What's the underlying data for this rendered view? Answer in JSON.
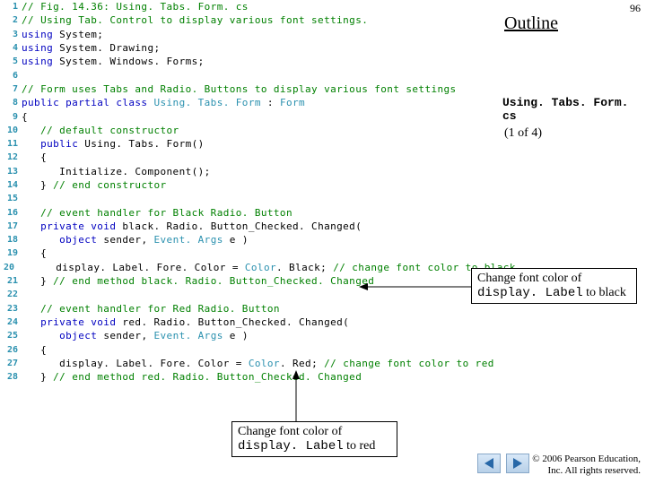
{
  "page_number": "96",
  "heading": "Outline",
  "source_file": "Using. Tabs. Form. cs",
  "page_indicator": "(1 of 4)",
  "callouts": {
    "black": {
      "line1": "Change font color of",
      "mono": "display. Label",
      "suffix": " to black"
    },
    "red": {
      "line1": "Change font color of",
      "mono": "display. Label",
      "suffix": " to red"
    }
  },
  "copyright": {
    "line1": "© 2006 Pearson Education,",
    "line2": "Inc. All rights reserved."
  },
  "nav": {
    "prev": "Previous slide",
    "next": "Next slide"
  },
  "code": {
    "l1": {
      "ln": "1",
      "ind": 0,
      "seg": [
        {
          "t": "// Fig. 14.36: Using. Tabs. Form. cs",
          "c": "c-comment"
        }
      ]
    },
    "l2": {
      "ln": "2",
      "ind": 0,
      "seg": [
        {
          "t": "// Using Tab. Control to display various font settings.",
          "c": "c-comment"
        }
      ]
    },
    "l3": {
      "ln": "3",
      "ind": 0,
      "seg": [
        {
          "t": "using ",
          "c": "c-key"
        },
        {
          "t": "System;",
          "c": "c-txt"
        }
      ]
    },
    "l4": {
      "ln": "4",
      "ind": 0,
      "seg": [
        {
          "t": "using ",
          "c": "c-key"
        },
        {
          "t": "System. Drawing;",
          "c": "c-txt"
        }
      ]
    },
    "l5": {
      "ln": "5",
      "ind": 0,
      "seg": [
        {
          "t": "using ",
          "c": "c-key"
        },
        {
          "t": "System. Windows. Forms;",
          "c": "c-txt"
        }
      ]
    },
    "l6": {
      "ln": "6",
      "ind": 0,
      "seg": [
        {
          "t": "",
          "c": "c-txt"
        }
      ]
    },
    "l7": {
      "ln": "7",
      "ind": 0,
      "seg": [
        {
          "t": "// Form uses Tabs and Radio. Buttons to display various font settings",
          "c": "c-comment"
        }
      ]
    },
    "l8": {
      "ln": "8",
      "ind": 0,
      "seg": [
        {
          "t": "public partial class ",
          "c": "c-key"
        },
        {
          "t": "Using. Tabs. Form",
          "c": "c-type"
        },
        {
          "t": " : ",
          "c": "c-txt"
        },
        {
          "t": "Form",
          "c": "c-type"
        }
      ]
    },
    "l9": {
      "ln": "9",
      "ind": 0,
      "seg": [
        {
          "t": "{",
          "c": "c-txt"
        }
      ]
    },
    "l10": {
      "ln": "10",
      "ind": 1,
      "seg": [
        {
          "t": "// default constructor",
          "c": "c-comment"
        }
      ]
    },
    "l11": {
      "ln": "11",
      "ind": 1,
      "seg": [
        {
          "t": "public ",
          "c": "c-key"
        },
        {
          "t": "Using. Tabs. Form()",
          "c": "c-txt"
        }
      ]
    },
    "l12": {
      "ln": "12",
      "ind": 1,
      "seg": [
        {
          "t": "{",
          "c": "c-txt"
        }
      ]
    },
    "l13": {
      "ln": "13",
      "ind": 2,
      "seg": [
        {
          "t": "Initialize. Component();",
          "c": "c-txt"
        }
      ]
    },
    "l14": {
      "ln": "14",
      "ind": 1,
      "seg": [
        {
          "t": "} ",
          "c": "c-txt"
        },
        {
          "t": "// end constructor",
          "c": "c-comment"
        }
      ]
    },
    "l15": {
      "ln": "15",
      "ind": 0,
      "seg": [
        {
          "t": "",
          "c": "c-txt"
        }
      ]
    },
    "l16": {
      "ln": "16",
      "ind": 1,
      "seg": [
        {
          "t": "// event handler for Black Radio. Button",
          "c": "c-comment"
        }
      ]
    },
    "l17": {
      "ln": "17",
      "ind": 1,
      "seg": [
        {
          "t": "private void ",
          "c": "c-key"
        },
        {
          "t": "black. Radio. Button_Checked. Changed(",
          "c": "c-txt"
        }
      ]
    },
    "l18": {
      "ln": "18",
      "ind": 2,
      "seg": [
        {
          "t": "object ",
          "c": "c-key"
        },
        {
          "t": "sender, ",
          "c": "c-txt"
        },
        {
          "t": "Event. Args",
          "c": "c-type"
        },
        {
          "t": " e )",
          "c": "c-txt"
        }
      ]
    },
    "l19": {
      "ln": "19",
      "ind": 1,
      "seg": [
        {
          "t": "{",
          "c": "c-txt"
        }
      ]
    },
    "l20": {
      "ln": "20",
      "ind": 2,
      "seg": [
        {
          "t": "display. Label. Fore. Color = ",
          "c": "c-txt"
        },
        {
          "t": "Color",
          "c": "c-type"
        },
        {
          "t": ". Black; ",
          "c": "c-txt"
        },
        {
          "t": "// change font color to black",
          "c": "c-comment"
        }
      ]
    },
    "l21": {
      "ln": "21",
      "ind": 1,
      "seg": [
        {
          "t": "} ",
          "c": "c-txt"
        },
        {
          "t": "// end method black. Radio. Button_Checked. Changed",
          "c": "c-comment"
        }
      ]
    },
    "l22": {
      "ln": "22",
      "ind": 0,
      "seg": [
        {
          "t": "",
          "c": "c-txt"
        }
      ]
    },
    "l23": {
      "ln": "23",
      "ind": 1,
      "seg": [
        {
          "t": "// event handler for Red Radio. Button",
          "c": "c-comment"
        }
      ]
    },
    "l24": {
      "ln": "24",
      "ind": 1,
      "seg": [
        {
          "t": "private void ",
          "c": "c-key"
        },
        {
          "t": "red. Radio. Button_Checked. Changed(",
          "c": "c-txt"
        }
      ]
    },
    "l25": {
      "ln": "25",
      "ind": 2,
      "seg": [
        {
          "t": "object ",
          "c": "c-key"
        },
        {
          "t": "sender, ",
          "c": "c-txt"
        },
        {
          "t": "Event. Args",
          "c": "c-type"
        },
        {
          "t": " e )",
          "c": "c-txt"
        }
      ]
    },
    "l26": {
      "ln": "26",
      "ind": 1,
      "seg": [
        {
          "t": "{",
          "c": "c-txt"
        }
      ]
    },
    "l27": {
      "ln": "27",
      "ind": 2,
      "seg": [
        {
          "t": "display. Label. Fore. Color = ",
          "c": "c-txt"
        },
        {
          "t": "Color",
          "c": "c-type"
        },
        {
          "t": ". Red; ",
          "c": "c-txt"
        },
        {
          "t": "// change font color to red",
          "c": "c-comment"
        }
      ]
    },
    "l28": {
      "ln": "28",
      "ind": 1,
      "seg": [
        {
          "t": "} ",
          "c": "c-txt"
        },
        {
          "t": "// end method red. Radio. Button_Checked. Changed",
          "c": "c-comment"
        }
      ]
    }
  }
}
